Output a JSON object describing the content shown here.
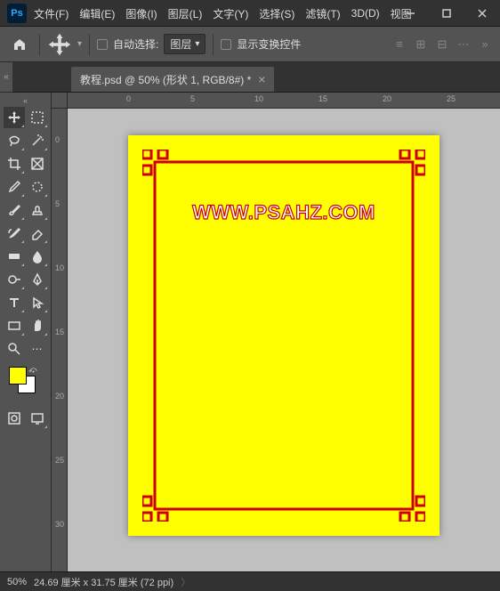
{
  "app_logo": "Ps",
  "menu": [
    "文件(F)",
    "编辑(E)",
    "图像(I)",
    "图层(L)",
    "文字(Y)",
    "选择(S)",
    "滤镜(T)",
    "3D(D)",
    "视图"
  ],
  "options": {
    "auto_select_label": "自动选择:",
    "auto_select_target": "图层",
    "show_transform_label": "显示变换控件"
  },
  "tab": {
    "title": "教程.psd @ 50% (形状 1, RGB/8#) *"
  },
  "ruler_h": [
    "0",
    "5",
    "10",
    "15",
    "20",
    "25"
  ],
  "ruler_v": [
    "0",
    "5",
    "10",
    "15",
    "20",
    "25",
    "30"
  ],
  "document": {
    "watermark": "WWW.PSAHZ.COM"
  },
  "swatch": {
    "fg": "#ffff00",
    "bg": "#ffffff"
  },
  "status": {
    "zoom": "50%",
    "dims": "24.69 厘米 x 31.75 厘米 (72 ppi)"
  }
}
